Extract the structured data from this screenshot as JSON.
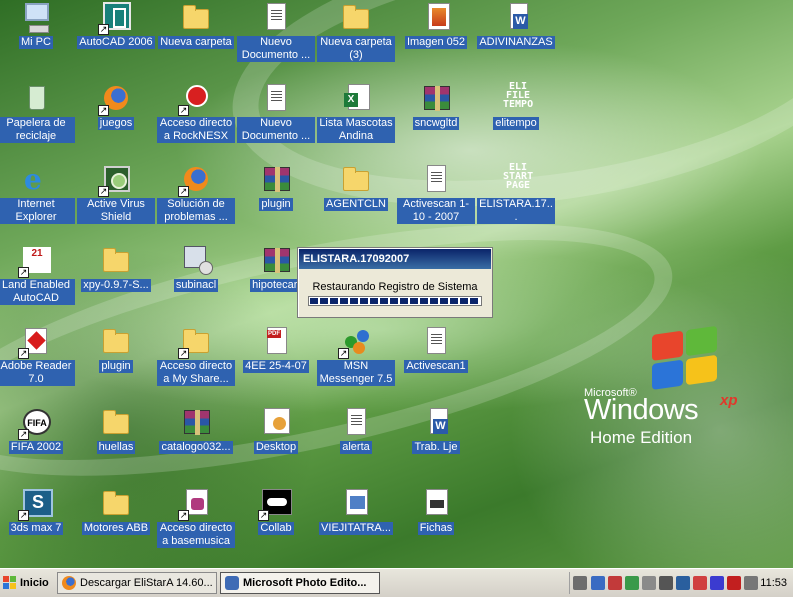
{
  "desktop": {
    "icons": [
      {
        "id": "mipc",
        "label": "Mi PC",
        "icon": "computer-icon"
      },
      {
        "id": "autocad",
        "label": "AutoCAD 2006",
        "icon": "autocad-icon"
      },
      {
        "id": "nueva-carpeta",
        "label": "Nueva carpeta",
        "icon": "folder-icon"
      },
      {
        "id": "nuevo-documento-1",
        "label": "Nuevo Documento ...",
        "icon": "document-icon"
      },
      {
        "id": "nueva-carpeta-3",
        "label": "Nueva carpeta (3)",
        "icon": "folder-icon"
      },
      {
        "id": "imagen-052",
        "label": "Imagen 052",
        "icon": "image-file-icon"
      },
      {
        "id": "adivinanzas",
        "label": "ADIVINANZAS",
        "icon": "word-document-icon"
      },
      {
        "id": "papelera",
        "label": "Papelera de reciclaje",
        "icon": "recycle-bin-icon"
      },
      {
        "id": "juegos",
        "label": "juegos",
        "icon": "firefox-icon"
      },
      {
        "id": "rocknesx",
        "label": "Acceso directo a RockNESX",
        "icon": "mario-icon"
      },
      {
        "id": "nuevo-documento-2",
        "label": "Nuevo Documento ...",
        "icon": "document-icon"
      },
      {
        "id": "lista-mascotas",
        "label": "Lista Mascotas Andina",
        "icon": "excel-icon"
      },
      {
        "id": "sncwgltd",
        "label": "sncwgltd",
        "icon": "winrar-icon"
      },
      {
        "id": "elitempo",
        "label": "elitempo",
        "icon": "eli-file-tempo-icon",
        "text": "ELI\nFILE\nTEMPO"
      },
      {
        "id": "internet-explorer",
        "label": "Internet Explorer",
        "icon": "internet-explorer-icon"
      },
      {
        "id": "avs",
        "label": "Active Virus Shield",
        "icon": "antivirus-icon"
      },
      {
        "id": "solucion",
        "label": "Solución de problemas ...",
        "icon": "firefox-icon"
      },
      {
        "id": "plugin-rar",
        "label": "plugin",
        "icon": "winrar-icon"
      },
      {
        "id": "agentcln",
        "label": "AGENTCLN",
        "icon": "folder-icon"
      },
      {
        "id": "activescan-2007",
        "label": "Activescan 1-10 - 2007",
        "icon": "document-icon"
      },
      {
        "id": "elistara-doc",
        "label": "ELISTARA.17...",
        "icon": "eli-start-page-icon",
        "text": "ELI\nSTART\nPAGE"
      },
      {
        "id": "land-enabled",
        "label": "Land Enabled AutoCAD",
        "icon": "land-autocad-icon",
        "text": "21"
      },
      {
        "id": "xpy",
        "label": "xpy-0.9.7-S...",
        "icon": "folder-icon"
      },
      {
        "id": "subinacl",
        "label": "subinacl",
        "icon": "installer-icon"
      },
      {
        "id": "hipotecari",
        "label": "hipotecari",
        "icon": "winrar-icon"
      },
      {
        "id": "adobe-reader",
        "label": "Adobe Reader 7.0",
        "icon": "adobe-reader-icon"
      },
      {
        "id": "plugin-folder",
        "label": "plugin",
        "icon": "folder-icon"
      },
      {
        "id": "my-share",
        "label": "Acceso directo a My Share...",
        "icon": "folder-icon"
      },
      {
        "id": "4ee",
        "label": "4EE 25-4-07",
        "icon": "pdf-icon"
      },
      {
        "id": "msn",
        "label": "MSN Messenger 7.5",
        "icon": "msn-messenger-icon"
      },
      {
        "id": "activescan1",
        "label": "Activescan1",
        "icon": "document-icon"
      },
      {
        "id": "fifa",
        "label": "FIFA 2002",
        "icon": "fifa-icon",
        "text": "FIFA"
      },
      {
        "id": "huellas",
        "label": "huellas",
        "icon": "folder-icon"
      },
      {
        "id": "catalogo",
        "label": "catalogo032...",
        "icon": "winrar-icon"
      },
      {
        "id": "desktop-file",
        "label": "Desktop",
        "icon": "desktop-file-icon"
      },
      {
        "id": "alerta",
        "label": "alerta",
        "icon": "document-icon"
      },
      {
        "id": "trab-lje",
        "label": "Trab. Lje",
        "icon": "word-document-icon"
      },
      {
        "id": "3dsmax",
        "label": "3ds max 7",
        "icon": "3ds-max-icon",
        "text": "S"
      },
      {
        "id": "motores",
        "label": "Motores ABB",
        "icon": "folder-icon"
      },
      {
        "id": "basemusica",
        "label": "Acceso directo a basemusica",
        "icon": "database-icon"
      },
      {
        "id": "collab",
        "label": "Collab",
        "icon": "collab-icon"
      },
      {
        "id": "viejitatra",
        "label": "VIEJITATRA...",
        "icon": "web-document-icon"
      },
      {
        "id": "fichas",
        "label": "Fichas",
        "icon": "fichas-icon"
      }
    ]
  },
  "logo": {
    "microsoft": "Microsoft®",
    "windows": "Windows",
    "xp": "xp",
    "edition": "Home Edition"
  },
  "dialog": {
    "title": "ELISTARA.17092007",
    "message": "Restaurando Registro de Sistema"
  },
  "taskbar": {
    "start_label": "Inicio",
    "tasks": [
      {
        "label": "Descargar EliStarA 14.60...",
        "icon": "firefox-icon",
        "active": false
      },
      {
        "label": "Microsoft Photo Edito...",
        "icon": "photo-editor-icon",
        "active": true
      }
    ],
    "clock": "11:53",
    "tray_icons": [
      "keyboard-icon",
      "network-icon",
      "security-icon",
      "app-icon",
      "printer-icon",
      "tool-icon",
      "display-icon",
      "virus-shield-icon",
      "speaker-icon",
      "acrobat-icon",
      "other-icon"
    ]
  }
}
